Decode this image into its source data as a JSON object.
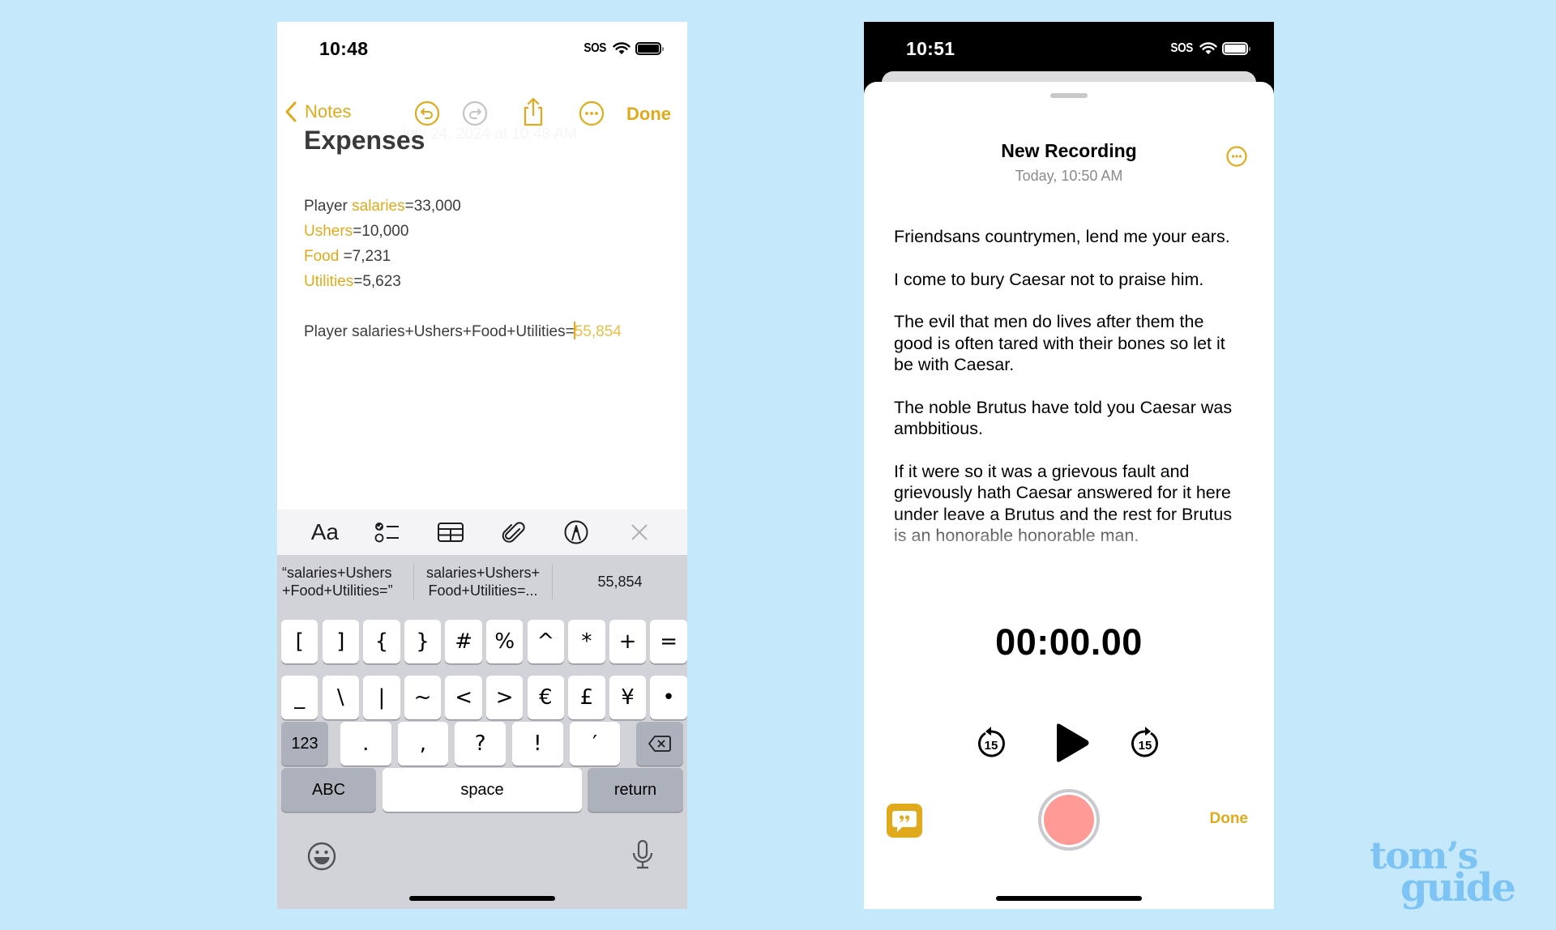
{
  "colors": {
    "background": "#c6e8fb",
    "accent": "#e0aa1c",
    "record": "#ff9a96",
    "keyboard_bg": "#d1d3d9",
    "logo": "#7dc4f5"
  },
  "notes_phone": {
    "status": {
      "time": "10:48",
      "carrier": "SOS",
      "icons": [
        "wifi-icon",
        "battery-icon"
      ]
    },
    "nav": {
      "back_label": "Notes",
      "icons": [
        "undo-icon",
        "redo-icon",
        "share-icon",
        "more-icon"
      ],
      "done_label": "Done",
      "ghost_date": "July 24, 2024 at 10:48 AM"
    },
    "note": {
      "title": "Expenses",
      "lines": [
        {
          "prefix": "Player ",
          "var": "salaries",
          "value": "=33,000"
        },
        {
          "prefix": "",
          "var": "Ushers",
          "value": "=10,000"
        },
        {
          "prefix": "",
          "var": "Food",
          "value": " =7,231"
        },
        {
          "prefix": "",
          "var": "Utilities",
          "value": "=5,623"
        }
      ],
      "formula": "Player salaries+Ushers+Food+Utilities=",
      "result": "55,854"
    },
    "format_bar": {
      "text_style_label": "Aa",
      "icons": [
        "text-format-icon",
        "checklist-icon",
        "table-icon",
        "attachment-icon",
        "markup-icon",
        "close-icon"
      ]
    },
    "keyboard": {
      "predictions": [
        "“salaries+Ushers +Food+Utilities=”",
        "salaries+Ushers+ Food+Utilities=...",
        "55,854"
      ],
      "row1": [
        "[",
        "]",
        "{",
        "}",
        "#",
        "%",
        "^",
        "*",
        "+",
        "="
      ],
      "row2": [
        "_",
        "\\",
        "|",
        "~",
        "<",
        ">",
        "€",
        "£",
        "¥",
        "•"
      ],
      "row3": [
        ".",
        ",",
        "?",
        "!",
        "′"
      ],
      "mode_123": "123",
      "abc": "ABC",
      "space": "space",
      "return": "return"
    }
  },
  "memo_phone": {
    "status": {
      "time": "10:51",
      "carrier": "SOS",
      "icons": [
        "wifi-icon",
        "battery-icon"
      ]
    },
    "recording": {
      "title": "New Recording",
      "date": "Today, 10:50 AM",
      "transcript": [
        "Friendsans countrymen, lend me your ears.",
        "I come to bury Caesar not to praise him.",
        "The evil that men do lives after them the good is often tared with their bones so let it be with Caesar.",
        "The noble Brutus have told you Caesar was ambbitious.",
        "If it were so it was a grievous fault and grievously hath Caesar answered for it here under leave a Brutus and the rest for Brutus is an honorable honorable man."
      ],
      "timer": "00:00.00",
      "skip_back_seconds": "15",
      "skip_forward_seconds": "15",
      "done_label": "Done"
    }
  },
  "watermark": {
    "line1": "tom’s",
    "line2": "guide"
  }
}
